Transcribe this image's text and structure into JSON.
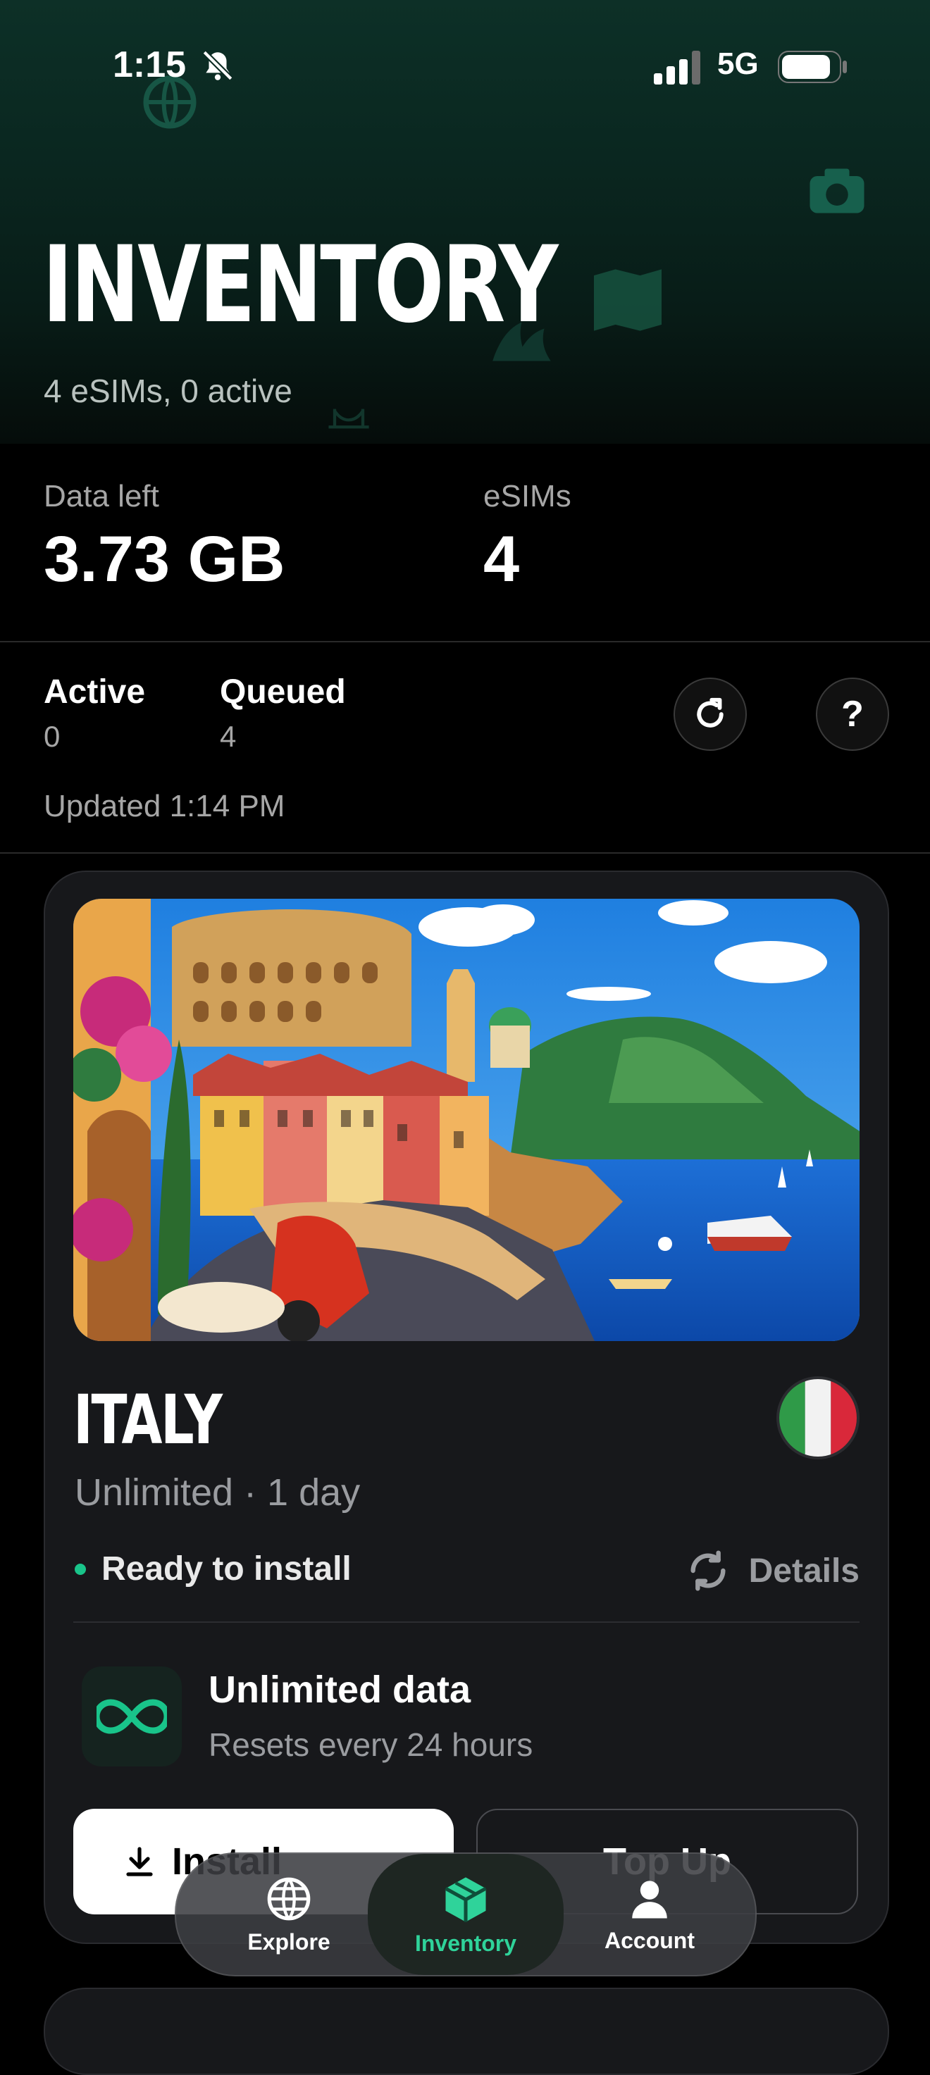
{
  "status_bar": {
    "time": "1:15",
    "network": "5G"
  },
  "header": {
    "title": "INVENTORY",
    "subtitle": "4 eSIMs, 0 active"
  },
  "stats": {
    "data_left_label": "Data left",
    "data_left_value": "3.73 GB",
    "esims_label": "eSIMs",
    "esims_value": "4"
  },
  "summary": {
    "active_label": "Active",
    "active_value": "0",
    "queued_label": "Queued",
    "queued_value": "4",
    "updated": "Updated 1:14 PM"
  },
  "card": {
    "country": "ITALY",
    "plan": "Unlimited · 1 day",
    "status": "Ready to install",
    "details_label": "Details",
    "feature_title": "Unlimited data",
    "feature_subtitle": "Resets every 24 hours",
    "install_label": "Install",
    "topup_label": "Top Up",
    "status_color": "#19c48a"
  },
  "tabbar": {
    "tabs": [
      {
        "label": "Explore",
        "icon": "globe-icon"
      },
      {
        "label": "Inventory",
        "icon": "box-icon",
        "active": true
      },
      {
        "label": "Account",
        "icon": "person-icon"
      }
    ],
    "accent": "#2fd39a"
  }
}
